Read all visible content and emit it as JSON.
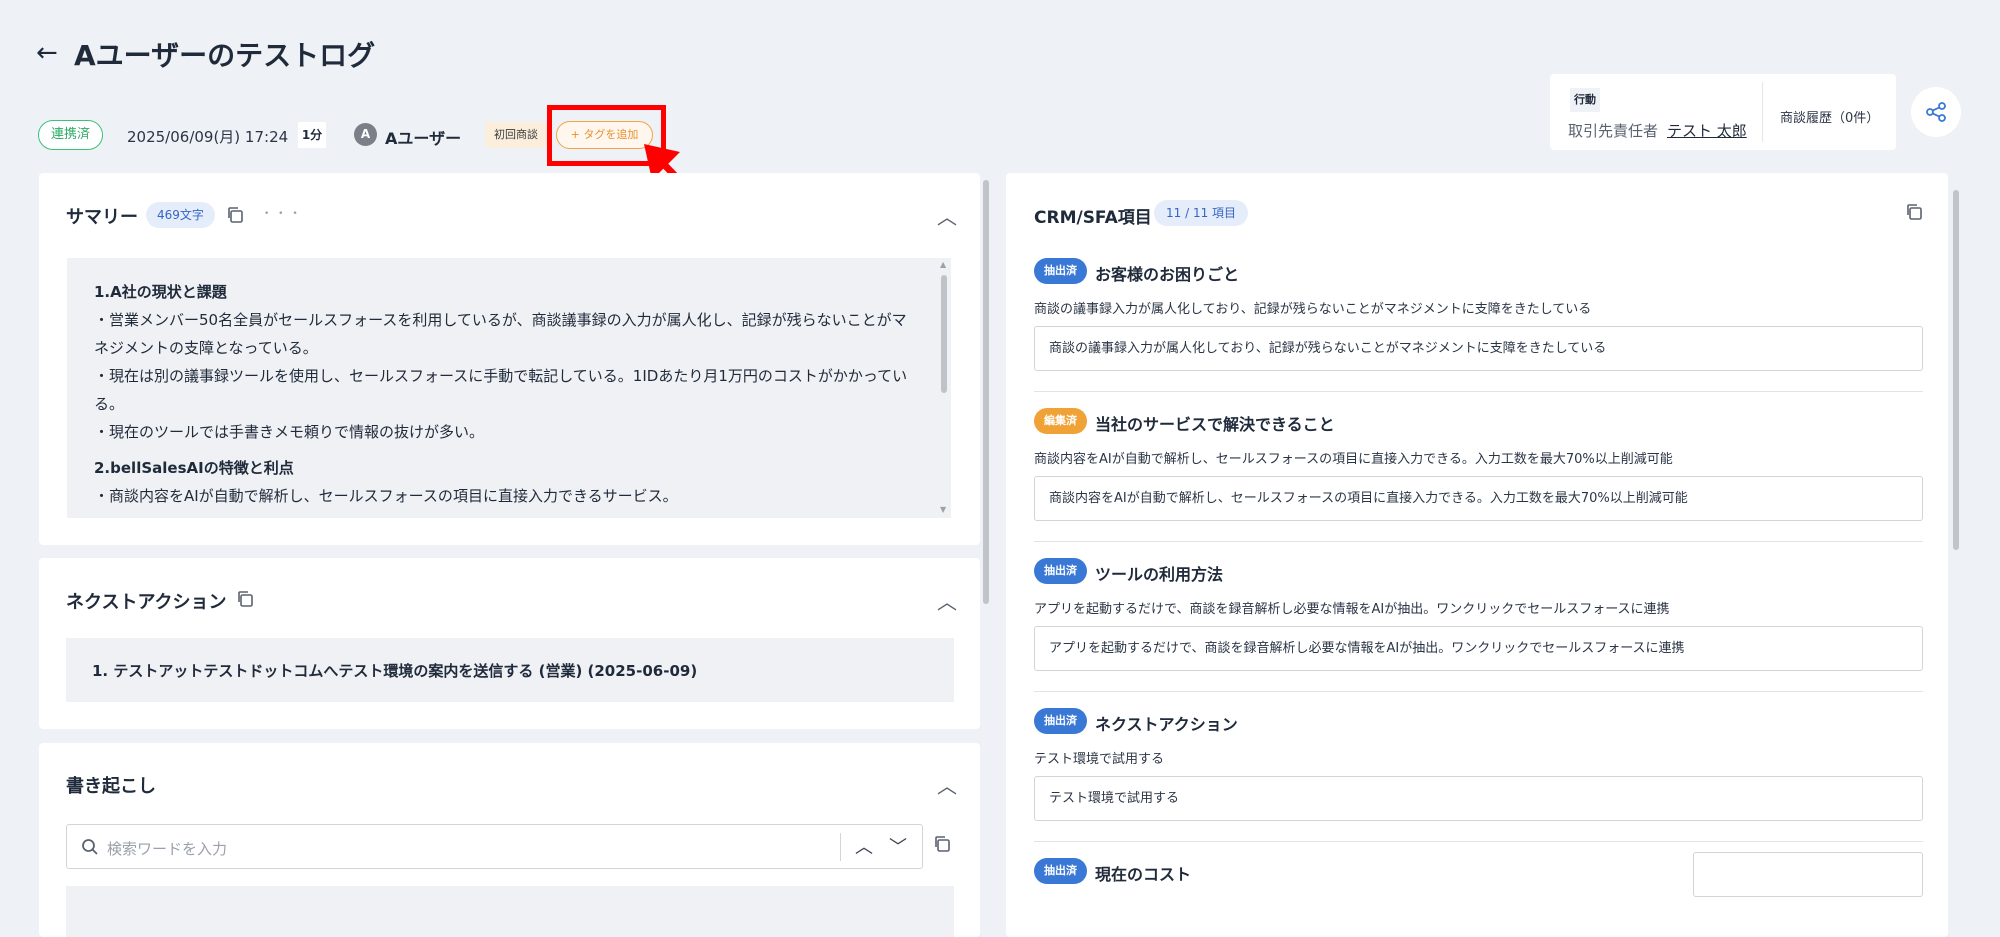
{
  "header": {
    "title": "Aユーザーのテストログ",
    "status_badge": "連携済",
    "datetime": "2025/06/09(月) 17:24",
    "duration": "1分",
    "avatar_initial": "A",
    "user_name": "Aユーザー",
    "tag": "初回商談",
    "add_tag_label": "+ タグを追加"
  },
  "info_card": {
    "action_tag": "行動",
    "contact_label": "取引先責任者",
    "contact_name": "テスト 太郎",
    "history_label": "商談履歴（0件）"
  },
  "summary": {
    "title": "サマリー",
    "char_count": "469文字",
    "more": "• • •",
    "lines": [
      {
        "text": "1.A社の現状と課題",
        "heading": true
      },
      {
        "text": "・営業メンバー50名全員がセールスフォースを利用しているが、商談議事録の入力が属人化し、記録が残らないことがマネジメントの支障となっている。",
        "heading": false
      },
      {
        "text": "・現在は別の議事録ツールを使用し、セールスフォースに手動で転記している。1IDあたり月1万円のコストがかかっている。",
        "heading": false
      },
      {
        "text": "・現在のツールでは手書きメモ頼りで情報の抜けが多い。",
        "heading": false
      },
      {
        "text": "2.bellSalesAIの特徴と利点",
        "heading": true
      },
      {
        "text": "・商談内容をAIが自動で解析し、セールスフォースの項目に直接入力できるサービス。",
        "heading": false
      }
    ]
  },
  "next_action": {
    "title": "ネクストアクション",
    "item": "1. テストアットテストドットコムへテスト環境の案内を送信する (営業) (2025-06-09)"
  },
  "transcript": {
    "title": "書き起こし",
    "search_placeholder": "検索ワードを入力"
  },
  "crm": {
    "title": "CRM/SFA項目",
    "count": "11 / 11 項目",
    "fields": [
      {
        "status": "抽出済",
        "status_color": "#3a78d6",
        "title": "お客様のお困りごと",
        "desc": "商談の議事録入力が属人化しており、記録が残らないことがマネジメントに支障をきたしている",
        "value": "商談の議事録入力が属人化しており、記録が残らないことがマネジメントに支障をきたしている"
      },
      {
        "status": "編集済",
        "status_color": "#f0a236",
        "title": "当社のサービスで解決できること",
        "desc": "商談内容をAIが自動で解析し、セールスフォースの項目に直接入力できる。入力工数を最大70%以上削減可能",
        "value": "商談内容をAIが自動で解析し、セールスフォースの項目に直接入力できる。入力工数を最大70%以上削減可能"
      },
      {
        "status": "抽出済",
        "status_color": "#3a78d6",
        "title": "ツールの利用方法",
        "desc": "アプリを起動するだけで、商談を録音解析し必要な情報をAIが抽出。ワンクリックでセールスフォースに連携",
        "value": "アプリを起動するだけで、商談を録音解析し必要な情報をAIが抽出。ワンクリックでセールスフォースに連携"
      },
      {
        "status": "抽出済",
        "status_color": "#3a78d6",
        "title": "ネクストアクション",
        "desc": "テスト環境で試用する",
        "value": "テスト環境で試用する"
      },
      {
        "status": "抽出済",
        "status_color": "#3a78d6",
        "title": "現在のコスト",
        "desc": "",
        "value": ""
      }
    ]
  }
}
